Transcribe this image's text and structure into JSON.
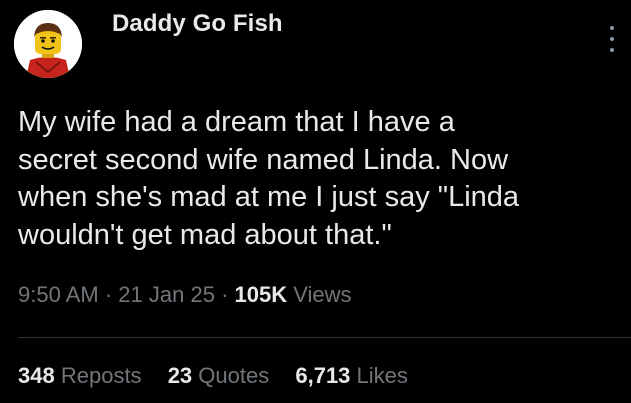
{
  "author": {
    "display_name": "Daddy Go Fish",
    "avatar_icon": "lego-minifigure-avatar"
  },
  "tweet": {
    "text": "My wife had a dream that I have a\nsecret second wife named Linda. Now\nwhen she's mad at me I just say \"Linda\nwouldn't get mad about that.\""
  },
  "meta": {
    "time": "9:50 AM",
    "separator": "·",
    "date": "21 Jan 25",
    "views_count": "105K",
    "views_label": "Views"
  },
  "stats": {
    "reposts_count": "348",
    "reposts_label": "Reposts",
    "quotes_count": "23",
    "quotes_label": "Quotes",
    "likes_count": "6,713",
    "likes_label": "Likes"
  },
  "colors": {
    "background": "#000000",
    "primary_text": "#e7e9ea",
    "secondary_text": "#71767b",
    "divider": "#2f3336"
  }
}
